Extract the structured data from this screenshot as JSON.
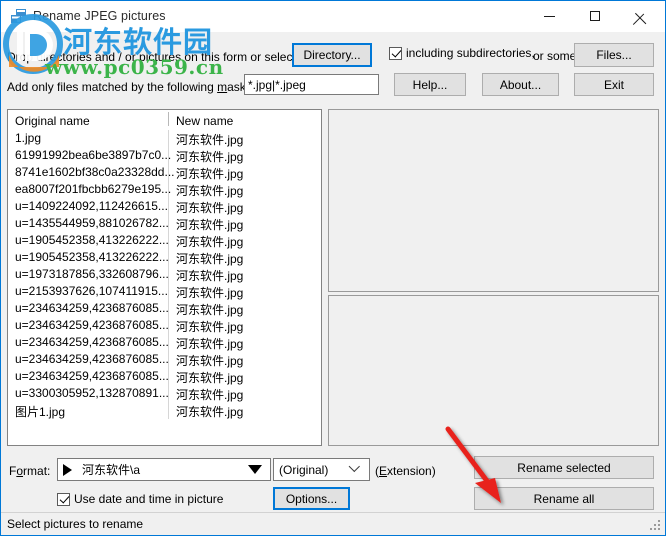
{
  "window": {
    "title": "Rename JPEG pictures",
    "icon": "app-picture-icon",
    "controls": {
      "minimize": "minimize-icon",
      "maximize": "maximize-icon",
      "close": "close-icon"
    }
  },
  "watermark": {
    "site_name_cn": "河东软件园",
    "url": "www.pc0359.cn",
    "color_blue": "#2a9ae0",
    "color_green": "#3cb44a",
    "color_orange": "#f08a24"
  },
  "top": {
    "drop_hint": "Drop directories and / or pictures on this form or select a",
    "directory_button": "Directory...",
    "including_subdirectories": "including subdirectories,",
    "including_subdirectories_checked": true,
    "or_some": "or some",
    "files_button": "Files...",
    "mask_label_pre": "Add only files matched by the following ",
    "mask_label_accesskey": "m",
    "mask_label_post": "ask(s) :",
    "mask_value": "*.jpg|*.jpeg",
    "help_button": "Help...",
    "about_button": "About...",
    "exit_button": "Exit"
  },
  "list": {
    "columns": [
      "Original name",
      "New name"
    ],
    "rows": [
      {
        "original": "1.jpg",
        "new": "河东软件.jpg"
      },
      {
        "original": "61991992bea6be3897b7c0...",
        "new": "河东软件.jpg"
      },
      {
        "original": "8741e1602bf38c0a23328dd...",
        "new": "河东软件.jpg"
      },
      {
        "original": "ea8007f201fbcbb6279e195...",
        "new": "河东软件.jpg"
      },
      {
        "original": "u=1409224092,112426615...",
        "new": "河东软件.jpg"
      },
      {
        "original": "u=1435544959,881026782...",
        "new": "河东软件.jpg"
      },
      {
        "original": "u=1905452358,413226222...",
        "new": "河东软件.jpg"
      },
      {
        "original": "u=1905452358,413226222...",
        "new": "河东软件.jpg"
      },
      {
        "original": "u=1973187856,332608796...",
        "new": "河东软件.jpg"
      },
      {
        "original": "u=2153937626,107411915...",
        "new": "河东软件.jpg"
      },
      {
        "original": "u=234634259,4236876085...",
        "new": "河东软件.jpg"
      },
      {
        "original": "u=234634259,4236876085...",
        "new": "河东软件.jpg"
      },
      {
        "original": "u=234634259,4236876085...",
        "new": "河东软件.jpg"
      },
      {
        "original": "u=234634259,4236876085...",
        "new": "河东软件.jpg"
      },
      {
        "original": "u=234634259,4236876085...",
        "new": "河东软件.jpg"
      },
      {
        "original": "u=3300305952,132870891...",
        "new": "河东软件.jpg"
      },
      {
        "original": "图片1.jpg",
        "new": "河东软件.jpg"
      }
    ]
  },
  "bottom": {
    "format_label_pre": "F",
    "format_label_accesskey": "o",
    "format_label_post": "rmat:",
    "format_value": "河东软件\\a",
    "extension_value": "(Original)",
    "extension_label_pre": "(",
    "extension_label_accesskey": "E",
    "extension_label_post": "xtension)",
    "use_date_checkbox": "Use date and time in picture",
    "use_date_checked": true,
    "options_button": "Options...",
    "rename_selected_button": "Rename selected",
    "rename_all_button": "Rename all"
  },
  "status": {
    "text": "Select pictures to rename"
  },
  "annotation": {
    "arrow_color": "#e8201a",
    "points_to": "rename-all-button"
  }
}
